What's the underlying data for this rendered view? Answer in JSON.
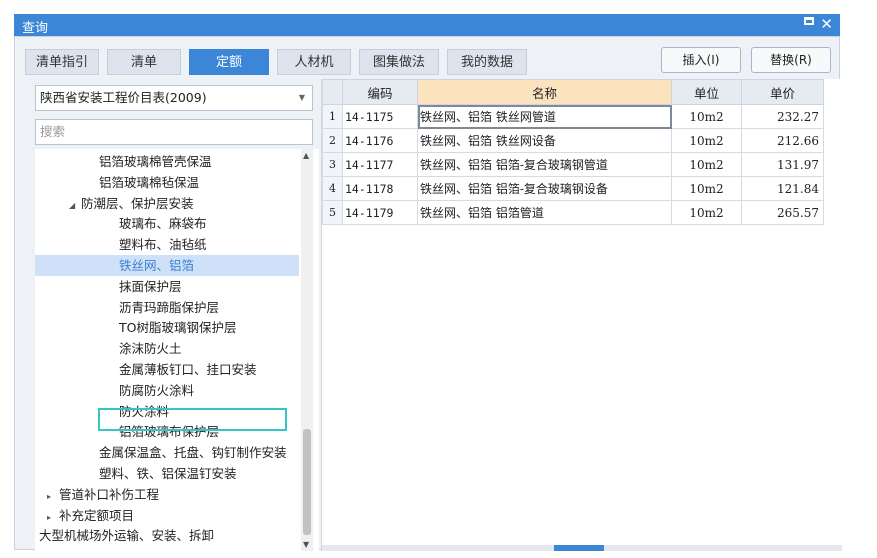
{
  "window": {
    "title": "查询",
    "maximize_glyph": "",
    "close_glyph": "✕"
  },
  "tabs": [
    {
      "label": "清单指引"
    },
    {
      "label": "清单"
    },
    {
      "label": "定额"
    },
    {
      "label": "人材机"
    },
    {
      "label": "图集做法"
    },
    {
      "label": "我的数据"
    }
  ],
  "active_tab": "定额",
  "buttons": {
    "insert": "插入(I)",
    "replace": "替换(R)"
  },
  "left_panel": {
    "catalog_selected": "陕西省安装工程价目表(2009)",
    "search_placeholder": "搜索",
    "tree": [
      {
        "label": "铝箔玻璃棉管壳保温",
        "arrow": "",
        "selected": false
      },
      {
        "label": "铝箔玻璃棉毡保温",
        "arrow": "",
        "selected": false
      },
      {
        "label": "防潮层、保护层安装",
        "arrow": "◢",
        "selected": false
      },
      {
        "label": "玻璃布、麻袋布",
        "arrow": "",
        "selected": false
      },
      {
        "label": "塑料布、油毡纸",
        "arrow": "",
        "selected": false
      },
      {
        "label": "铁丝网、铝箔",
        "arrow": "",
        "selected": true
      },
      {
        "label": "抹面保护层",
        "arrow": "",
        "selected": false
      },
      {
        "label": "沥青玛蹄脂保护层",
        "arrow": "",
        "selected": false
      },
      {
        "label": "TO树脂玻璃钢保护层",
        "arrow": "",
        "selected": false
      },
      {
        "label": "涂沫防火土",
        "arrow": "",
        "selected": false
      },
      {
        "label": "金属薄板钉口、挂口安装",
        "arrow": "",
        "selected": false
      },
      {
        "label": "防腐防火涂料",
        "arrow": "",
        "selected": false
      },
      {
        "label": "防火涂料",
        "arrow": "",
        "selected": false
      },
      {
        "label": "铝箔玻璃布保护层",
        "arrow": "",
        "selected": false
      },
      {
        "label": "金属保温盒、托盘、钩钉制作安装",
        "arrow": "",
        "selected": false
      },
      {
        "label": "塑料、铁、铝保温钉安装",
        "arrow": "",
        "selected": false
      },
      {
        "label": "管道补口补伤工程",
        "arrow": "▸",
        "selected": false
      },
      {
        "label": "补充定额项目",
        "arrow": "▸",
        "selected": false
      },
      {
        "label": "大型机械场外运输、安装、拆卸",
        "arrow": "▸",
        "selected": false
      }
    ]
  },
  "grid": {
    "columns": [
      "编码",
      "名称",
      "单位",
      "单价"
    ],
    "rows": [
      {
        "n": "1",
        "code": "14-1175",
        "name": "铁丝网、铝箔 铁丝网管道",
        "unit": "10m2",
        "price": "232.27"
      },
      {
        "n": "2",
        "code": "14-1176",
        "name": "铁丝网、铝箔 铁丝网设备",
        "unit": "10m2",
        "price": "212.66"
      },
      {
        "n": "3",
        "code": "14-1177",
        "name": "铁丝网、铝箔 铝箔-复合玻璃钢管道",
        "unit": "10m2",
        "price": "131.97"
      },
      {
        "n": "4",
        "code": "14-1178",
        "name": "铁丝网、铝箔 铝箔-复合玻璃钢设备",
        "unit": "10m2",
        "price": "121.84"
      },
      {
        "n": "5",
        "code": "14-1179",
        "name": "铁丝网、铝箔 铝箔管道",
        "unit": "10m2",
        "price": "265.57"
      }
    ]
  },
  "colors": {
    "accent": "#3b86d6",
    "name_header": "#fbe3bf",
    "selected_tree_item": "#cfe1f8",
    "highlight_box": "#34c6c6"
  }
}
